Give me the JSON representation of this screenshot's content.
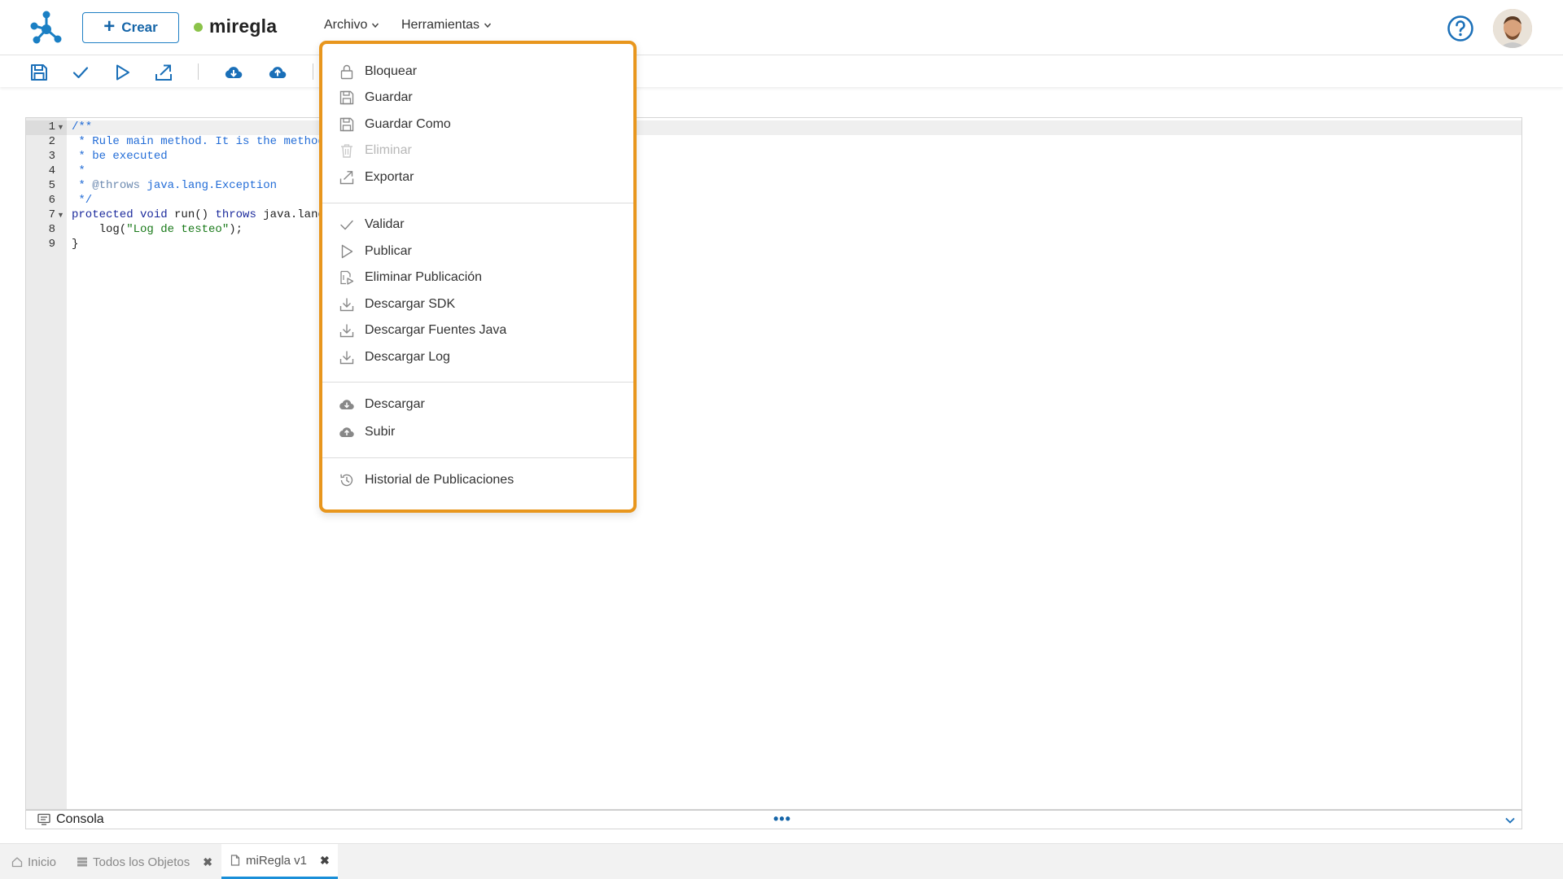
{
  "header": {
    "create_label": "Crear",
    "rule_name": "miregla",
    "rule_status_color": "#8bc34a",
    "menus": {
      "archivo": "Archivo",
      "herramientas": "Herramientas"
    },
    "help_icon": "help-circle-icon",
    "avatar_icon": "user-avatar"
  },
  "toolbar": {
    "icons": [
      "save-icon",
      "check-icon",
      "play-icon",
      "export-icon",
      "cloud-download-icon",
      "cloud-upload-icon"
    ]
  },
  "editor": {
    "line_numbers": [
      "1",
      "2",
      "3",
      "4",
      "5",
      "6",
      "7",
      "8",
      "9"
    ],
    "lines": {
      "l1": "/**",
      "l2": " * Rule main method. It is the method",
      "l3": " * be executed",
      "l4": " *",
      "l5a": " * ",
      "l5b": "@throws",
      "l5c": " java.lang.Exception",
      "l6": " */",
      "l7a": "protected void",
      "l7b": " run() ",
      "l7c": "throws",
      "l7d": " java.lang",
      "l8a": "    log(",
      "l8b": "\"Log de testeo\"",
      "l8c": ");",
      "l9": "}"
    },
    "colors": {
      "comment": "#236dd7",
      "keyword": "#1b2a9c",
      "string": "#1a7a1a"
    }
  },
  "console": {
    "label": "Consola",
    "dots": "•••"
  },
  "tabs": [
    {
      "label": "Inicio",
      "icon": "home-icon",
      "closable": false
    },
    {
      "label": "Todos los Objetos",
      "icon": "list-icon",
      "closable": true
    },
    {
      "label": "miRegla v1",
      "icon": "document-icon",
      "closable": true,
      "active": true
    }
  ],
  "dropdown": {
    "accent_color": "#e8961d",
    "groups": [
      [
        {
          "label": "Bloquear",
          "icon": "lock-icon",
          "disabled": false
        },
        {
          "label": "Guardar",
          "icon": "save-icon",
          "disabled": false
        },
        {
          "label": "Guardar Como",
          "icon": "save-as-icon",
          "disabled": false
        },
        {
          "label": "Eliminar",
          "icon": "trash-icon",
          "disabled": true
        },
        {
          "label": "Exportar",
          "icon": "export-icon",
          "disabled": false
        }
      ],
      [
        {
          "label": "Validar",
          "icon": "check-icon",
          "disabled": false
        },
        {
          "label": "Publicar",
          "icon": "play-icon",
          "disabled": false
        },
        {
          "label": "Eliminar Publicación",
          "icon": "unpublish-icon",
          "disabled": false
        },
        {
          "label": "Descargar SDK",
          "icon": "download-icon",
          "disabled": false
        },
        {
          "label": "Descargar Fuentes Java",
          "icon": "download-icon",
          "disabled": false
        },
        {
          "label": "Descargar Log",
          "icon": "download-icon",
          "disabled": false
        }
      ],
      [
        {
          "label": "Descargar",
          "icon": "cloud-download-icon",
          "disabled": false
        },
        {
          "label": "Subir",
          "icon": "cloud-upload-icon",
          "disabled": false
        }
      ],
      [
        {
          "label": "Historial de Publicaciones",
          "icon": "history-icon",
          "disabled": false
        }
      ]
    ]
  }
}
